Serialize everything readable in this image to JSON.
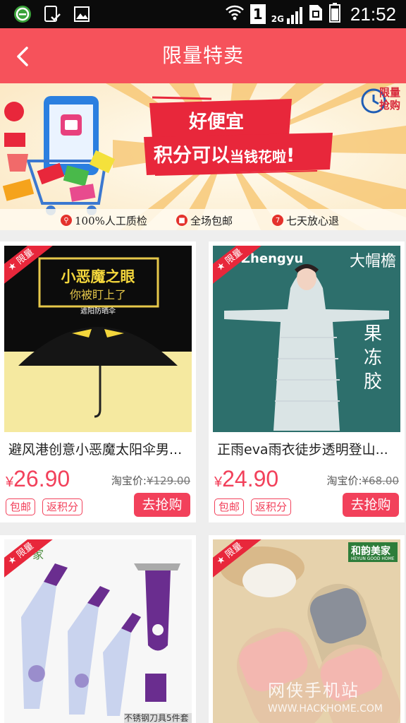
{
  "status_bar": {
    "time": "21:52",
    "sim_slot": "1",
    "network": "2G",
    "icons": [
      "browser-icon",
      "download-check-icon",
      "image-icon",
      "wifi-icon",
      "sim-icon",
      "signal-icon",
      "battery-icon"
    ]
  },
  "header": {
    "title": "限量特卖",
    "back_icon": "chevron-left-icon",
    "background": "#f6525b"
  },
  "banner": {
    "headline": "好便宜",
    "subline_main": "积分可以",
    "subline_small": "当钱花啦",
    "subline_end": "!",
    "flash_badge": [
      "限量",
      "抢购"
    ],
    "guarantees": [
      {
        "icon": "magnifier-icon",
        "text": "100%人工质检"
      },
      {
        "icon": "truck-icon",
        "text": "全场包邮"
      },
      {
        "icon": "seven-day-icon",
        "text": "七天放心退"
      }
    ]
  },
  "product_ribbon": "限量",
  "products": [
    {
      "name": "避风港创意小恶魔太阳伞男...",
      "currency": "¥",
      "price": "26.90",
      "taobao_label": "淘宝价:",
      "taobao_price": "¥129.00",
      "tags": [
        "包邮",
        "返积分"
      ],
      "buy_label": "去抢购",
      "image_text": [
        "小恶魔之眼",
        "你被盯上了",
        "遮阳防晒伞"
      ]
    },
    {
      "name": "正雨eva雨衣徒步透明登山...",
      "currency": "¥",
      "price": "24.90",
      "taobao_label": "淘宝价:",
      "taobao_price": "¥68.00",
      "tags": [
        "包邮",
        "返积分"
      ],
      "buy_label": "去抢购",
      "image_text": [
        "Zhengyu",
        "大帽檐",
        "果",
        "冻",
        "胶"
      ]
    },
    {
      "name": "",
      "image_text": [
        "家",
        "不锈钢刀具5件套"
      ]
    },
    {
      "name": "",
      "image_text": [
        "和韵美家",
        "HEYUN GOOD HOME"
      ]
    }
  ],
  "watermark": {
    "text": "网侠手机站",
    "url": "WWW.HACKHOME.COM"
  },
  "colors": {
    "accent": "#f2415b",
    "ribbon": "#e8273b",
    "page_bg": "#eeeeee"
  }
}
